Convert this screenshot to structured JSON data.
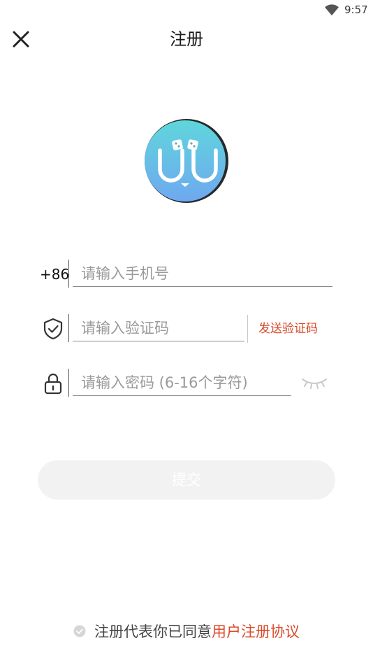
{
  "status_bar": {
    "time": "9:57",
    "wifi_icon": "wifi-icon"
  },
  "header": {
    "title": "注册",
    "close_icon": "close-icon"
  },
  "logo": {
    "text": "UU",
    "bg_color": "#6EC9E8"
  },
  "form": {
    "phone": {
      "prefix": "+86",
      "placeholder": "请输入手机号",
      "value": ""
    },
    "code": {
      "icon": "shield-check-icon",
      "placeholder": "请输入验证码",
      "value": "",
      "send_label": "发送验证码"
    },
    "password": {
      "icon": "lock-icon",
      "placeholder": "请输入密码 (6-16个字符)",
      "value": "",
      "toggle_icon": "eye-closed-icon"
    }
  },
  "submit": {
    "label": "提交",
    "enabled": false
  },
  "agreement": {
    "text": "注册代表你已同意",
    "link": "用户注册协议",
    "checked": false
  },
  "colors": {
    "accent": "#D94A2B",
    "button_bg": "#F2F2F2",
    "logo_gradient_top": "#5FD6DC",
    "logo_gradient_bottom": "#6FA8F0"
  }
}
